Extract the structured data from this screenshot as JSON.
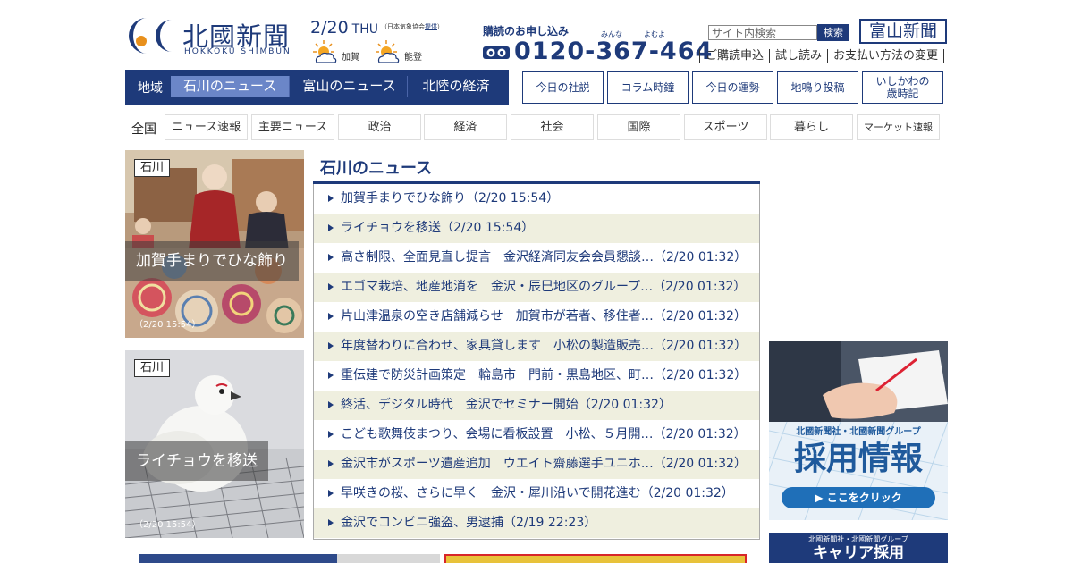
{
  "header": {
    "logo_name": "北國新聞",
    "logo_sub": "HOKKOKU SHIMBUN",
    "date": "2/20",
    "weekday": "THU",
    "weather_source_prefix": "（日本気象協会",
    "weather_source_link": "提供",
    "weather_source_suffix": "）",
    "weather": [
      {
        "area": "加賀",
        "icon": "sun-cloud-icon"
      },
      {
        "area": "能登",
        "icon": "sun-cloud-icon"
      }
    ],
    "subscribe_label": "購読のお申し込み",
    "ruby_1": "みんな",
    "ruby_2": "よむよ",
    "phone": "0120-367-464",
    "search_placeholder": "サイト内検索",
    "search_button": "検索",
    "toyama_logo": "富山新聞",
    "util_links": [
      "ご購読申込",
      "試し読み",
      "お支払い方法の変更"
    ]
  },
  "region_nav": {
    "label": "地域",
    "tabs": [
      "石川のニュース",
      "富山のニュース",
      "北陸の経済"
    ],
    "active": 0
  },
  "feature_buttons": [
    "今日の社説",
    "コラム時鐘",
    "今日の運勢",
    "地鳴り投稿",
    "いしかわの",
    "歳時記"
  ],
  "category_nav": {
    "label": "全国",
    "items": [
      "ニュース速報",
      "主要ニュース",
      "政治",
      "経済",
      "社会",
      "国際",
      "スポーツ",
      "暮らし",
      "マーケット速報"
    ]
  },
  "photo_cards": [
    {
      "tag": "石川",
      "title": "加賀手まりでひな飾り",
      "time": "（2/20 15:54）"
    },
    {
      "tag": "石川",
      "title": "ライチョウを移送",
      "time": "（2/20 15:54）"
    }
  ],
  "news": {
    "heading": "石川のニュース",
    "items": [
      "加賀手まりでひな飾り（2/20 15:54）",
      "ライチョウを移送（2/20 15:54）",
      "高さ制限、全面見直し提言　金沢経済同友会会員懇談…（2/20 01:32）",
      "エゴマ栽培、地産地消を　金沢・辰巳地区のグループ…（2/20 01:32）",
      "片山津温泉の空き店舗減らせ　加賀市が若者、移住者…（2/20 01:32）",
      "年度替わりに合わせ、家具貸します　小松の製造販売…（2/20 01:32）",
      "重伝建で防災計画策定　輪島市　門前・黒島地区、町…（2/20 01:32）",
      "終活、デジタル時代　金沢でセミナー開始（2/20 01:32）",
      "こども歌舞伎まつり、会場に看板設置　小松、５月開…（2/20 01:32）",
      "金沢市がスポーツ遺産追加　ウエイト齋藤選手ユニホ…（2/20 01:32）",
      "早咲きの桜、さらに早く　金沢・犀川沿いで開花進む（2/20 01:32）",
      "金沢でコンビニ強盗、男逮捕（2/19 22:23）"
    ]
  },
  "banners": {
    "recruit_small": "北國新聞社・北國新聞グループ",
    "recruit_title": "採用情報",
    "recruit_button": "▶ ここをクリック",
    "career_small": "北國新聞社・北國新聞グループ",
    "career_title": "キャリア採用"
  },
  "colors": {
    "brand": "#1e3a7a",
    "active_tab": "#6b86c8",
    "alt_row": "#efefdf"
  }
}
